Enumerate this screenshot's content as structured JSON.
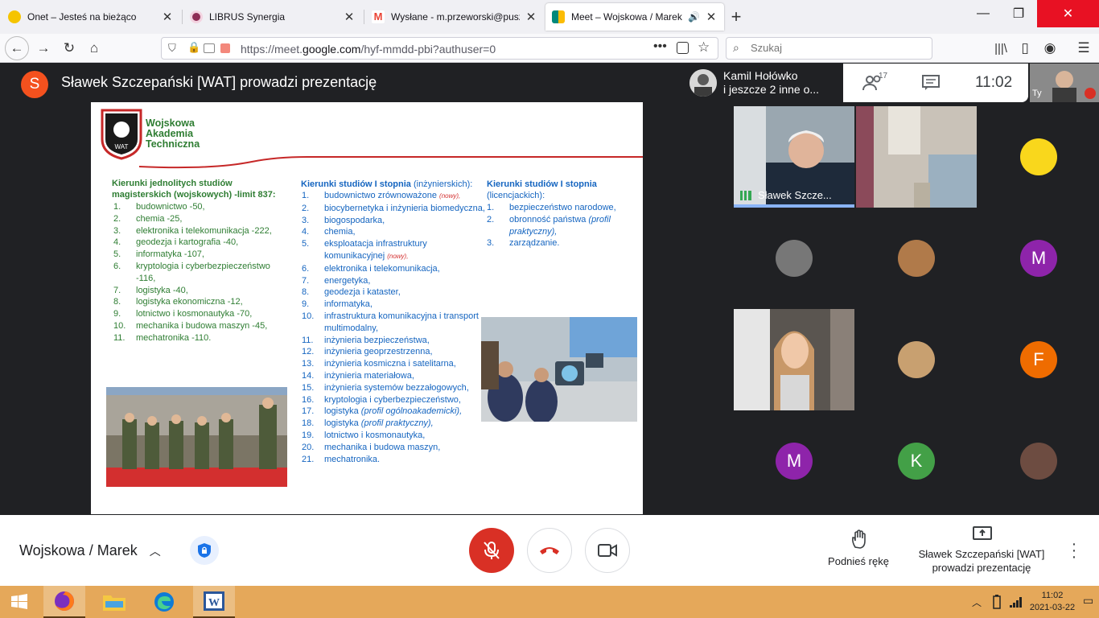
{
  "browser": {
    "tabs": [
      {
        "title": "Onet – Jesteś na bieżąco",
        "color": "#f5c400"
      },
      {
        "title": "LIBRUS Synergia",
        "color": "#8e2c55"
      },
      {
        "title": "Wysłane - m.przeworski@puszk",
        "color": "#ea4335"
      },
      {
        "title": "Meet – Wojskowa / Marek",
        "color": "#00897b"
      }
    ],
    "url_prefix": "https://meet.",
    "url_domain": "google.com",
    "url_path": "/hyf-mmdd-pbi?authuser=0",
    "search_placeholder": "Szukaj"
  },
  "meet": {
    "presenter_initial": "S",
    "presenter_text": "Sławek Szczepański [WAT] prowadzi prezentację",
    "participants_line1": "Kamil Hołówko",
    "participants_line2": "i jeszcze 2 inne o...",
    "participant_count": "17",
    "clock": "11:02",
    "self_label": "Ty",
    "meeting_name": "Wojskowa / Marek",
    "raise_hand": "Podnieś rękę",
    "presenting_line1": "Sławek Szczepański [WAT]",
    "presenting_line2": "prowadzi prezentację"
  },
  "slide": {
    "logo_lines": [
      "Wojskowa",
      "Akademia",
      "Techniczna"
    ],
    "col1_head": "Kierunki jednolitych studiów magisterskich (wojskowych) -limit 837:",
    "col1": [
      "budownictwo -50,",
      "chemia -25,",
      "elektronika i telekomunikacja -222,",
      "geodezja i kartografia -40,",
      "informatyka -107,",
      "kryptologia i cyberbezpieczeństwo -116,",
      "logistyka -40,",
      "logistyka ekonomiczna -12,",
      "lotnictwo i kosmonautyka -70,",
      "mechanika i budowa maszyn -45,",
      "mechatronika -110."
    ],
    "col2_head": "Kierunki studiów I stopnia",
    "col2_head_suffix": " (inżynierskich):",
    "col2_new": "(nowy),",
    "col2": [
      "budownictwo zrównoważone",
      "biocybernetyka i inżynieria biomedyczna,",
      "biogospodarka,",
      "chemia,",
      "eksploatacja infrastruktury komunikacyjnej",
      "elektronika i telekomunikacja,",
      "energetyka,",
      "geodezja i kataster,",
      "informatyka,",
      "infrastruktura komunikacyjna i transport multimodalny,",
      "inżynieria bezpieczeństwa,",
      "inżynieria geoprzestrzenna,",
      "inżynieria kosmiczna i satelitarna,",
      "inżynieria materiałowa,",
      "inżynieria systemów bezzałogowych,",
      "kryptologia i cyberbezpieczeństwo,",
      "logistyka",
      "logistyka",
      "lotnictwo i kosmonautyka,",
      "mechanika i budowa maszyn,",
      "mechatronika."
    ],
    "col2_italic_17": "(profil ogólnoakademicki),",
    "col2_italic_18": "(profil praktyczny),",
    "col3_head": "Kierunki studiów I stopnia",
    "col3_head2": "(licencjackich):",
    "col3": [
      "bezpieczeństwo narodowe,",
      "obronność państwa",
      "zarządzanie."
    ],
    "col3_italic": "(profil praktyczny),"
  },
  "grid": {
    "tiles": [
      {
        "type": "video",
        "name": "Sławek Szcze..."
      },
      {
        "type": "video",
        "name": ""
      },
      {
        "type": "avatar",
        "initial": "",
        "color": "#f9d71c"
      },
      {
        "type": "avatar",
        "initial": "",
        "color": "#777777"
      },
      {
        "type": "avatar",
        "initial": "",
        "color": "#b07a4a"
      },
      {
        "type": "avatar",
        "initial": "M",
        "color": "#8e24aa"
      },
      {
        "type": "video",
        "name": ""
      },
      {
        "type": "avatar",
        "initial": "",
        "color": "#c8a070"
      },
      {
        "type": "avatar",
        "initial": "F",
        "color": "#ef6c00"
      },
      {
        "type": "avatar",
        "initial": "M",
        "color": "#8e24aa"
      },
      {
        "type": "avatar",
        "initial": "K",
        "color": "#43a047"
      },
      {
        "type": "avatar",
        "initial": "",
        "color": "#6d4c41"
      }
    ]
  },
  "taskbar": {
    "time": "11:02",
    "date": "2021-03-22"
  }
}
